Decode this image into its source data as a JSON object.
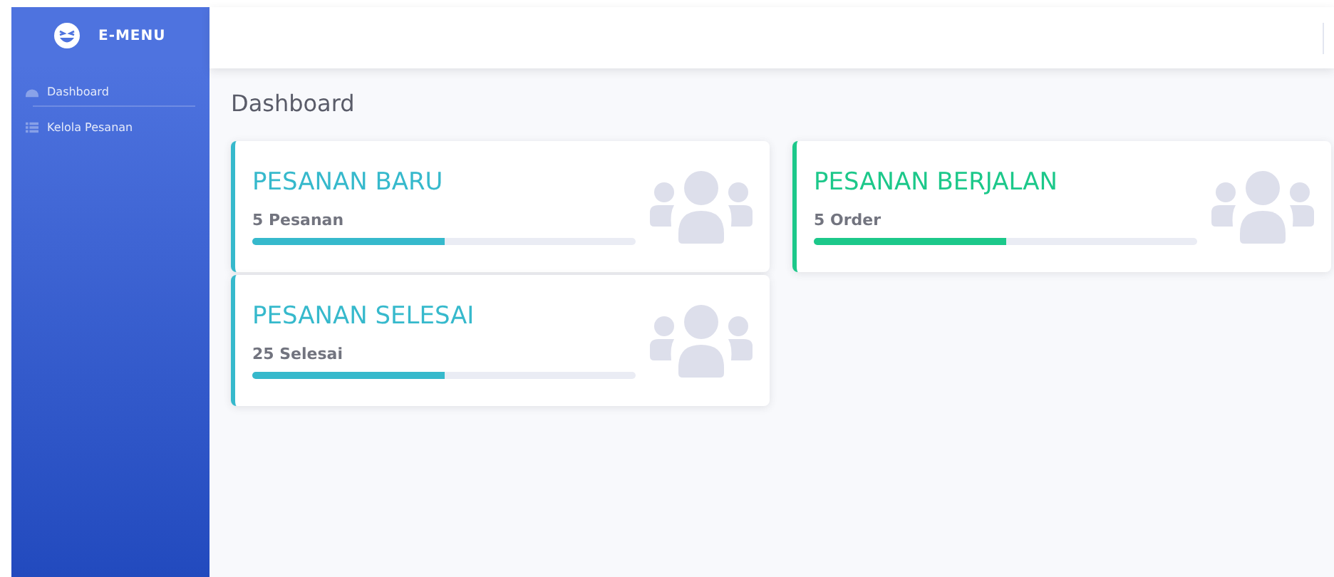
{
  "brand": {
    "name": "E-MENU"
  },
  "sidebar": {
    "items": [
      {
        "label": "Dashboard",
        "kind": "dashboard"
      },
      {
        "label": "Kelola Pesanan",
        "kind": "list"
      }
    ]
  },
  "page_title": "Dashboard",
  "cards": [
    {
      "title": "PESANAN BARU",
      "subtitle": "5 Pesanan",
      "level": 0.5,
      "color": "#36b9cc"
    },
    {
      "title": "PESANAN BERJALAN",
      "subtitle": "5 Order",
      "level": 0.5,
      "color": "#1cc88a"
    },
    {
      "title": "PESANAN SELESAI",
      "subtitle": "25 Selesai",
      "level": 0.5,
      "color": "#36b9cc"
    }
  ]
}
